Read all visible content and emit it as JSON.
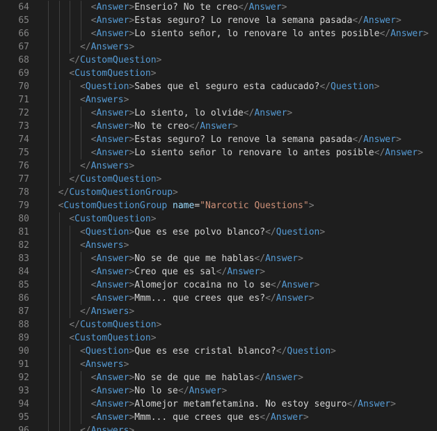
{
  "editor": {
    "colors": {
      "background": "#1e1e1e",
      "line_number": "#858585",
      "bracket": "#808080",
      "tag": "#569cd6",
      "text": "#d4d4d4",
      "attribute": "#9cdcfe",
      "string": "#ce9178"
    },
    "lines": [
      {
        "num": "64",
        "indent": 4,
        "tag": "Answer",
        "text": "Enserio? No te creo"
      },
      {
        "num": "65",
        "indent": 4,
        "tag": "Answer",
        "text": "Estas seguro? Lo renove la semana pasada"
      },
      {
        "num": "66",
        "indent": 4,
        "tag": "Answer",
        "text": "Lo siento señor, lo renovare lo antes posible"
      },
      {
        "num": "67",
        "indent": 3,
        "close": "Answers"
      },
      {
        "num": "68",
        "indent": 2,
        "close": "CustomQuestion"
      },
      {
        "num": "69",
        "indent": 2,
        "open": "CustomQuestion"
      },
      {
        "num": "70",
        "indent": 3,
        "tag": "Question",
        "text": "Sabes que el seguro esta caducado?"
      },
      {
        "num": "71",
        "indent": 3,
        "open": "Answers"
      },
      {
        "num": "72",
        "indent": 4,
        "tag": "Answer",
        "text": "Lo siento, lo olvide"
      },
      {
        "num": "73",
        "indent": 4,
        "tag": "Answer",
        "text": "No te creo"
      },
      {
        "num": "74",
        "indent": 4,
        "tag": "Answer",
        "text": "Estas seguro? Lo renove la semana pasada"
      },
      {
        "num": "75",
        "indent": 4,
        "tag": "Answer",
        "text": "Lo siento señor lo renovare lo antes posible"
      },
      {
        "num": "76",
        "indent": 3,
        "close": "Answers"
      },
      {
        "num": "77",
        "indent": 2,
        "close": "CustomQuestion"
      },
      {
        "num": "78",
        "indent": 1,
        "close": "CustomQuestionGroup"
      },
      {
        "num": "79",
        "indent": 1,
        "open": "CustomQuestionGroup",
        "attr_name": "name",
        "attr_value": "\"Narcotic Questions\""
      },
      {
        "num": "80",
        "indent": 2,
        "open": "CustomQuestion"
      },
      {
        "num": "81",
        "indent": 3,
        "tag": "Question",
        "text": "Que es ese polvo blanco?"
      },
      {
        "num": "82",
        "indent": 3,
        "open": "Answers"
      },
      {
        "num": "83",
        "indent": 4,
        "tag": "Answer",
        "text": "No se de que me hablas"
      },
      {
        "num": "84",
        "indent": 4,
        "tag": "Answer",
        "text": "Creo que es sal"
      },
      {
        "num": "85",
        "indent": 4,
        "tag": "Answer",
        "text": "Alomejor cocaina no lo se"
      },
      {
        "num": "86",
        "indent": 4,
        "tag": "Answer",
        "text": "Mmm... que crees que es?"
      },
      {
        "num": "87",
        "indent": 3,
        "close": "Answers"
      },
      {
        "num": "88",
        "indent": 2,
        "close": "CustomQuestion"
      },
      {
        "num": "89",
        "indent": 2,
        "open": "CustomQuestion"
      },
      {
        "num": "90",
        "indent": 3,
        "tag": "Question",
        "text": "Que es ese cristal blanco?"
      },
      {
        "num": "91",
        "indent": 3,
        "open": "Answers"
      },
      {
        "num": "92",
        "indent": 4,
        "tag": "Answer",
        "text": "No se de que me hablas"
      },
      {
        "num": "93",
        "indent": 4,
        "tag": "Answer",
        "text": "No lo se"
      },
      {
        "num": "94",
        "indent": 4,
        "tag": "Answer",
        "text": "Alomejor metamfetamina. No estoy seguro"
      },
      {
        "num": "95",
        "indent": 4,
        "tag": "Answer",
        "text": "Mmm... que crees que es"
      },
      {
        "num": "96",
        "indent": 3,
        "close": "Answers"
      }
    ]
  }
}
